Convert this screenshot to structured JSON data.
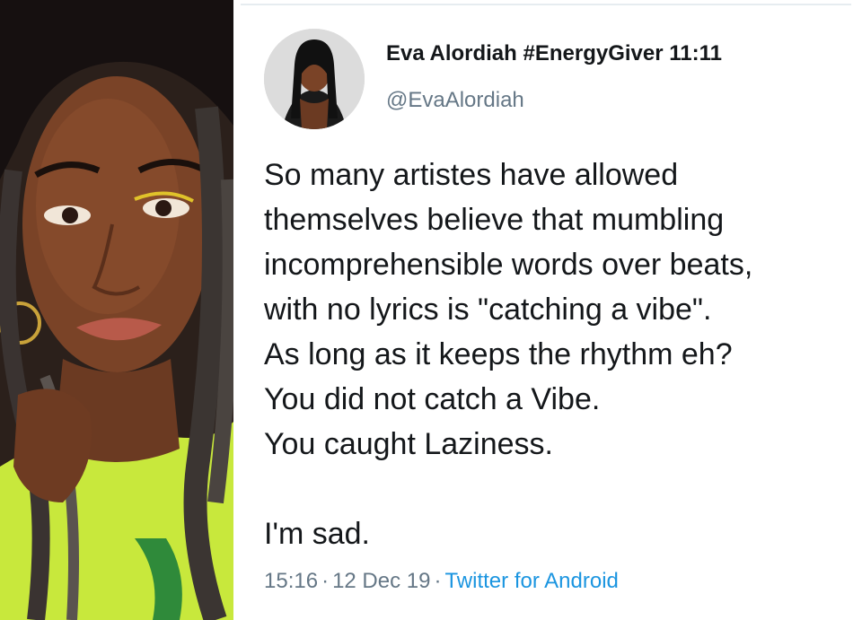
{
  "tweet": {
    "display_name": "Eva Alordiah #EnergyGiver 11:11",
    "handle": "@EvaAlordiah",
    "lines": [
      "So many artistes have allowed",
      "themselves believe that mumbling",
      "incomprehensible words over beats,",
      "with no lyrics is \"catching a vibe\".",
      "As long as it keeps the rhythm eh?",
      "You did not catch a Vibe.",
      "You caught Laziness."
    ],
    "closing_line": "I'm sad.",
    "time": "15:16",
    "date": "12 Dec 19",
    "source": "Twitter for Android",
    "separator": "·"
  },
  "colors": {
    "text_primary": "#14171a",
    "text_secondary": "#657786",
    "link": "#1b95e0",
    "shirt": "#c7e63a"
  }
}
